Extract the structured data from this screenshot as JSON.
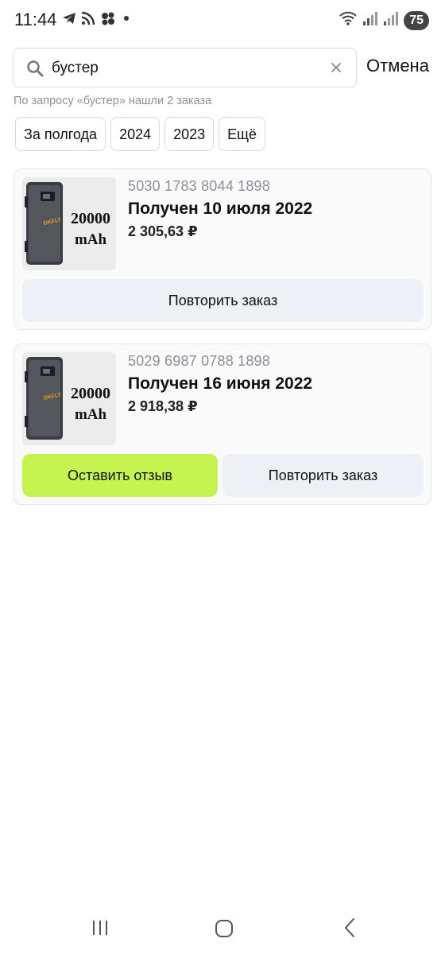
{
  "status_bar": {
    "time": "11:44",
    "battery": "75",
    "icons": [
      "telegram-icon",
      "rss-icon",
      "app-cluster-icon",
      "dot-icon",
      "wifi-icon",
      "signal-icon",
      "signal-icon"
    ]
  },
  "search": {
    "query": "бустер",
    "placeholder": "",
    "cancel_label": "Отмена",
    "result_text": "По запросу «бустер» нашли 2 заказа"
  },
  "filters": [
    "За полгода",
    "2024",
    "2023",
    "Ещё"
  ],
  "orders": [
    {
      "number": "5030 1783 8044 1898",
      "status": "Получен 10 июля 2022",
      "price": "2 305,63 ₽",
      "image_text": [
        "20000",
        "mAh"
      ],
      "brand": "OKFLY",
      "buttons": [
        "Повторить заказ"
      ]
    },
    {
      "number": "5029 6987 0788 1898",
      "status": "Получен 16 июня 2022",
      "price": "2 918,38 ₽",
      "image_text": [
        "20000",
        "mAh"
      ],
      "brand": "OKFLY",
      "buttons": [
        "Оставить отзыв",
        "Повторить заказ"
      ]
    }
  ],
  "colors": {
    "accent_green": "#c5f451",
    "button_gray": "#edf0f5",
    "muted_text": "#8a8f98"
  }
}
